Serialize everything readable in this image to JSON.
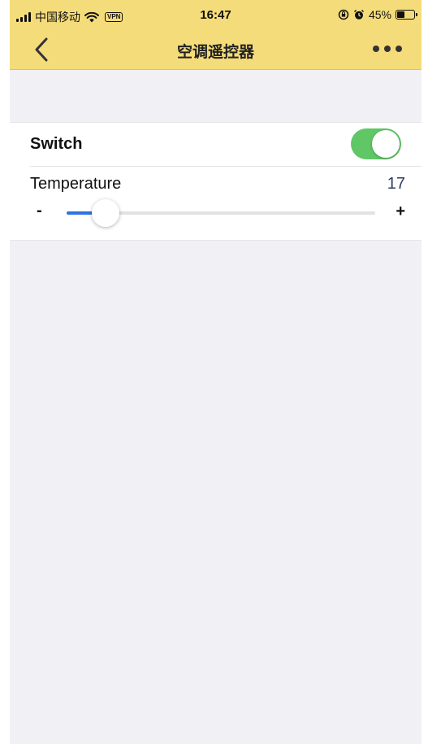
{
  "status_bar": {
    "carrier": "中国移动",
    "vpn": "VPN",
    "time": "16:47",
    "battery_percent": "45%",
    "battery_level": 0.45
  },
  "nav": {
    "title": "空调遥控器",
    "back_icon": "chevron-left-icon",
    "more_icon": "ellipsis-icon"
  },
  "controls": {
    "switch": {
      "label": "Switch",
      "on": true,
      "color": "#5fc765"
    },
    "temperature": {
      "label": "Temperature",
      "value": "17",
      "minus_label": "-",
      "plus_label": "+",
      "slider_fraction": 0.125,
      "accent": "#2f72e0"
    }
  },
  "colors": {
    "header": "#f5dc7a",
    "background": "#f1f1f5"
  }
}
